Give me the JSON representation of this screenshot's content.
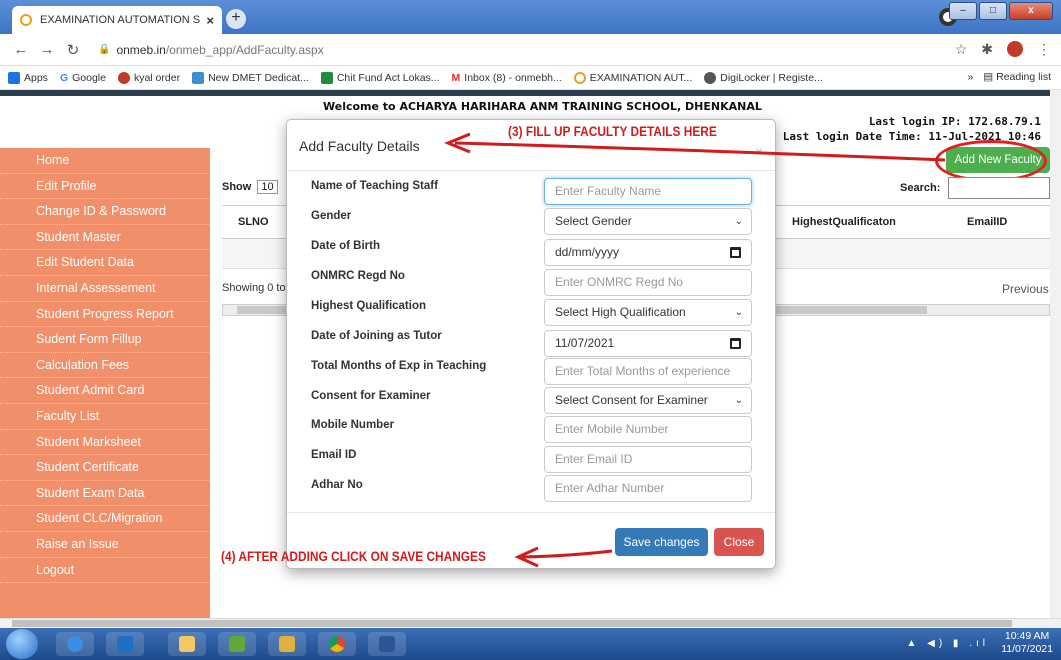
{
  "browser": {
    "tab_title": "EXAMINATION AUTOMATION SY",
    "url_host": "onmeb.in",
    "url_path": "/onmeb_app/AddFaculty.aspx",
    "bookmarks": [
      "Apps",
      "Google",
      "kyal order",
      "New DMET Dedicat...",
      "Chit Fund Act Lokas...",
      "Inbox (8) - onmebh...",
      "EXAMINATION AUT...",
      "DigiLocker | Registe..."
    ],
    "reading_list": "Reading list",
    "more": "»"
  },
  "header": {
    "welcome": "Welcome to  ACHARYA HARIHARA ANM TRAINING SCHOOL, DHENKANAL",
    "last_login_ip": "Last login IP: 172.68.79.1",
    "last_login_time": "Last login Date Time: 11-Jul-2021 10:46"
  },
  "sidebar": {
    "items": [
      "Home",
      "Edit Profile",
      "Change ID & Password",
      "Student Master",
      "Edit Student Data",
      "Internal Assessement",
      "Student Progress Report",
      "Sudent Form Fillup",
      "Calculation Fees",
      "Student Admit Card",
      "Faculty List",
      "Student Marksheet",
      "Student Certificate",
      "Student Exam Data",
      "Student CLC/Migration",
      "Raise an Issue",
      "Logout"
    ]
  },
  "table": {
    "show_label": "Show",
    "show_value": "10",
    "search_label": "Search:",
    "columns": [
      "SLNO",
      "HighestQualificaton",
      "EmailID"
    ],
    "showing": "Showing 0 to",
    "previous": "Previous",
    "add_button": "Add New Faculty"
  },
  "modal": {
    "title": "Add Faculty Details",
    "close_icon": "×",
    "fields": [
      {
        "label": "Name of Teaching Staff",
        "value": "Enter Faculty Name"
      },
      {
        "label": "Gender",
        "value": "Select Gender"
      },
      {
        "label": "Date of Birth",
        "value": "dd/mm/yyyy"
      },
      {
        "label": "ONMRC Regd No",
        "value": "Enter ONMRC Regd No"
      },
      {
        "label": "Highest Qualification",
        "value": "Select High Qualification"
      },
      {
        "label": "Date of Joining as Tutor",
        "value": "11/07/2021"
      },
      {
        "label": "Total Months of Exp in Teaching",
        "value": "Enter Total Months of experience"
      },
      {
        "label": "Consent for Examiner",
        "value": "Select Consent for Examiner"
      },
      {
        "label": "Mobile Number",
        "value": "Enter Mobile Number"
      },
      {
        "label": "Email ID",
        "value": "Enter Email ID"
      },
      {
        "label": "Adhar No",
        "value": "Enter Adhar Number"
      }
    ],
    "save_label": "Save changes",
    "close_label": "Close"
  },
  "annotations": {
    "step3": "(3) FILL UP FACULTY DETAILS HERE",
    "step4": "(4) AFTER ADDING CLICK ON SAVE CHANGES",
    "color": "#d21c1c"
  },
  "taskbar": {
    "time": "10:49 AM",
    "date": "11/07/2021"
  },
  "colors": {
    "sidebar": "#f18f6b",
    "add_button": "#4cae4c",
    "save_button": "#337ab7",
    "close_button": "#d9534f"
  }
}
